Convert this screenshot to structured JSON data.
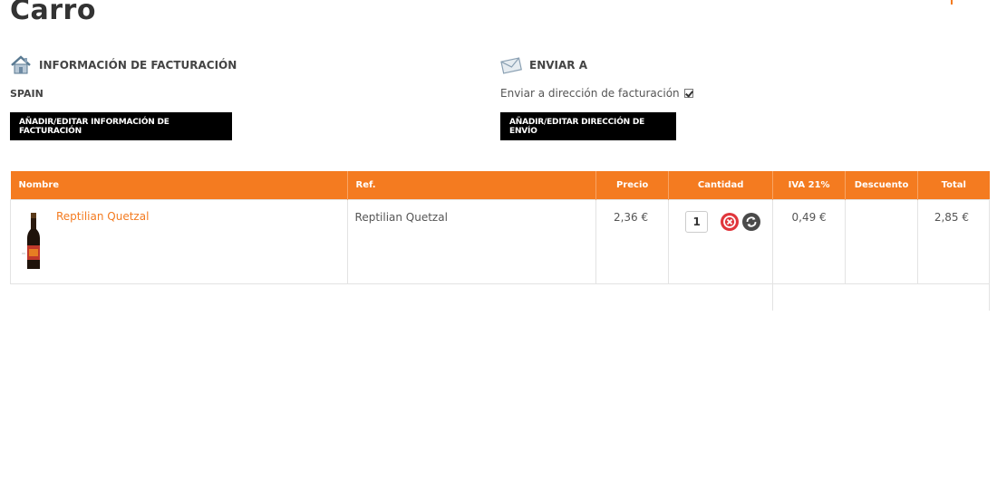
{
  "page": {
    "title": "Carro"
  },
  "billing": {
    "heading": "INFORMACIÓN DE FACTURACIÓN",
    "country": "SPAIN",
    "button_label": "AÑADIR/EDITAR INFORMACIÓN DE FACTURACIÓN",
    "icon": "house-icon"
  },
  "shipping": {
    "heading": "ENVIAR A",
    "same_as_billing_label": "Enviar a dirección de facturación",
    "same_as_billing_checked": true,
    "button_label": "AÑADIR/EDITAR DIRECCIÓN DE ENVÍO",
    "icon": "envelope-icon"
  },
  "cart": {
    "columns": [
      "Nombre",
      "Ref.",
      "Precio",
      "Cantidad",
      "IVA 21%",
      "Descuento",
      "Total"
    ],
    "items": [
      {
        "name": "Reptilian Quetzal",
        "ref": "Reptilian Quetzal",
        "price": "2,36 €",
        "quantity": "1",
        "vat": "0,49 €",
        "discount": "",
        "total": "2,85 €"
      }
    ]
  },
  "colors": {
    "accent": "#f47b20",
    "button_bg": "#000000"
  }
}
